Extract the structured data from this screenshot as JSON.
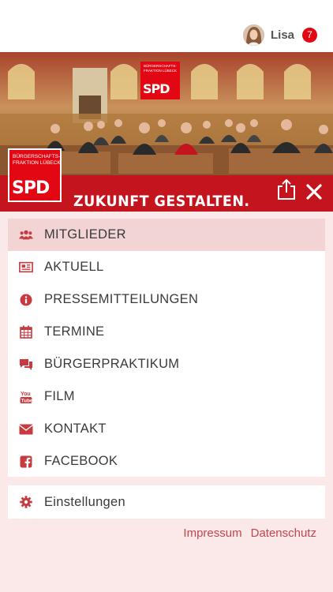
{
  "user": {
    "name": "Lisa",
    "notification_count": "7"
  },
  "banner": {
    "logo_subtitle": "BÜRGERSCHAFTS- FRAKTION LÜBECK",
    "logo_text": "SPD",
    "slogan": "ZUKUNFT GESTALTEN.",
    "share_icon": "share-icon",
    "close_icon": "close-icon"
  },
  "menu": {
    "items": [
      {
        "label": "MITGLIEDER",
        "icon": "group-icon",
        "active": true
      },
      {
        "label": "AKTUELL",
        "icon": "newspaper-icon",
        "active": false
      },
      {
        "label": "PRESSEMITTEILUNGEN",
        "icon": "info-icon",
        "active": false
      },
      {
        "label": "TERMINE",
        "icon": "calendar-icon",
        "active": false
      },
      {
        "label": "BÜRGERPRAKTIKUM",
        "icon": "chat-icon",
        "active": false
      },
      {
        "label": "FILM",
        "icon": "youtube-icon",
        "active": false
      },
      {
        "label": "KONTAKT",
        "icon": "envelope-icon",
        "active": false
      },
      {
        "label": "FACEBOOK",
        "icon": "facebook-icon",
        "active": false
      }
    ]
  },
  "settings": {
    "label": "Einstellungen",
    "icon": "gear-icon"
  },
  "footer": {
    "impressum": "Impressum",
    "datenschutz": "Datenschutz"
  },
  "colors": {
    "brand_red": "#e30613",
    "bar_red": "#c4141d",
    "icon_red": "#c73a40",
    "active_bg": "#f2d4d4",
    "page_bg": "#fbe9e9"
  }
}
